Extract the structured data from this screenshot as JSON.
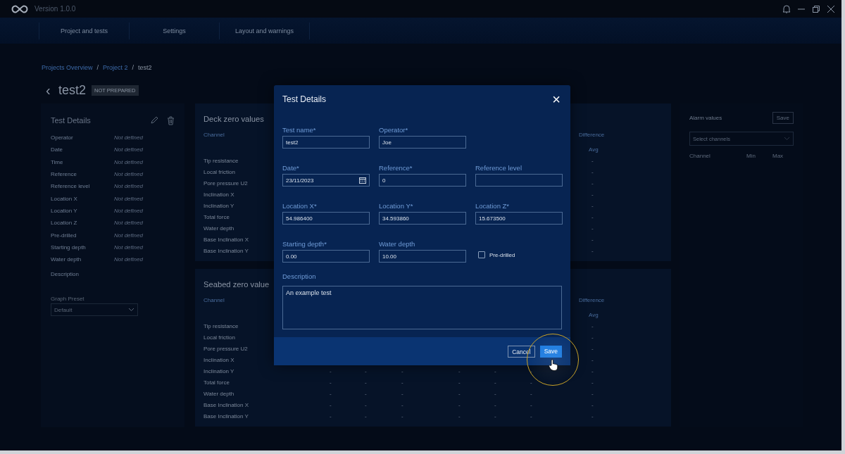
{
  "titlebar": {
    "version": "Version 1.0.0"
  },
  "nav": {
    "tabs": [
      {
        "label": "Project and tests"
      },
      {
        "label": "Settings"
      },
      {
        "label": "Layout and warnings"
      }
    ]
  },
  "breadcrumb": {
    "links": [
      "Projects Overview",
      "Project 2"
    ],
    "separator": "/",
    "current": "test2"
  },
  "page": {
    "back": "‹",
    "title": "test2",
    "status": "NOT PREPARED"
  },
  "details": {
    "title": "Test Details",
    "rows": [
      {
        "label": "Operator",
        "value": "Not defined"
      },
      {
        "label": "Date",
        "value": "Not defined"
      },
      {
        "label": "Time",
        "value": "Not defined"
      },
      {
        "label": "Reference",
        "value": "Not defined"
      },
      {
        "label": "Reference level",
        "value": "Not defined"
      },
      {
        "label": "Location X",
        "value": "Not defined"
      },
      {
        "label": "Location Y",
        "value": "Not defined"
      },
      {
        "label": "Location Z",
        "value": "Not defined"
      },
      {
        "label": "Pre-drilled",
        "value": "Not defined"
      },
      {
        "label": "Starting depth",
        "value": "Not defined"
      },
      {
        "label": "Water depth",
        "value": "Not defined"
      }
    ],
    "description_label": "Description",
    "preset_label": "Graph Preset",
    "preset_value": "Default"
  },
  "zero_tables": [
    {
      "title": "Deck zero values",
      "header": {
        "channel": "Channel",
        "group": "Difference",
        "sub": "Avg"
      },
      "rows": [
        {
          "channel": "Tip resistance",
          "values": [
            "-"
          ]
        },
        {
          "channel": "Local friction",
          "values": [
            "-"
          ]
        },
        {
          "channel": "Pore pressure U2",
          "values": [
            "-"
          ]
        },
        {
          "channel": "Inclination X",
          "values": [
            "-"
          ]
        },
        {
          "channel": "Inclination Y",
          "values": [
            "-"
          ]
        },
        {
          "channel": "Total force",
          "values": [
            "-"
          ]
        },
        {
          "channel": "Water depth",
          "values": [
            "-"
          ]
        },
        {
          "channel": "Base Inclination X",
          "values": [
            "-"
          ]
        },
        {
          "channel": "Base Inclination Y",
          "values": [
            "-"
          ]
        }
      ]
    },
    {
      "title": "Seabed zero value",
      "header": {
        "channel": "Channel",
        "group": "Difference",
        "sub": "Avg"
      },
      "rows": [
        {
          "channel": "Tip resistance",
          "values": [
            "-"
          ]
        },
        {
          "channel": "Local friction",
          "values": [
            "-"
          ]
        },
        {
          "channel": "Pore pressure U2",
          "values": [
            "-"
          ]
        },
        {
          "channel": "Inclination X",
          "values": [
            "-"
          ]
        },
        {
          "channel": "Inclination Y",
          "values": [
            "-",
            "-",
            "-",
            "-",
            "-",
            "-",
            "-"
          ]
        },
        {
          "channel": "Total force",
          "values": [
            "-",
            "-",
            "-",
            "-",
            "-",
            "-",
            "-"
          ]
        },
        {
          "channel": "Water depth",
          "values": [
            "-",
            "-",
            "-",
            "-",
            "-",
            "-",
            "-"
          ]
        },
        {
          "channel": "Base Inclination X",
          "values": [
            "-",
            "-",
            "-",
            "-",
            "-",
            "-",
            "-"
          ]
        },
        {
          "channel": "Base Inclination Y",
          "values": [
            "-",
            "-",
            "-",
            "-",
            "-",
            "-",
            "-"
          ]
        }
      ]
    }
  ],
  "alarm": {
    "title": "Alarm values",
    "save": "Save",
    "select_placeholder": "Select channels",
    "columns": [
      "Channel",
      "Min",
      "Max"
    ]
  },
  "modal": {
    "title": "Test Details",
    "close": "×",
    "rows": [
      [
        {
          "kind": "text",
          "label": "Test name*",
          "value": "test2"
        },
        {
          "kind": "text",
          "label": "Operator*",
          "value": "Joe"
        }
      ],
      [
        {
          "kind": "date",
          "label": "Date*",
          "value": "23/11/2023"
        },
        {
          "kind": "text",
          "label": "Reference*",
          "value": "0"
        },
        {
          "kind": "text",
          "label": "Reference level"
        }
      ],
      [
        {
          "kind": "text",
          "label": "Location X*",
          "value": "54.986400"
        },
        {
          "kind": "text",
          "label": "Location Y*",
          "value": "34.593860"
        },
        {
          "kind": "text",
          "label": "Location Z*",
          "value": "15.673500"
        }
      ],
      [
        {
          "kind": "text",
          "label": "Starting depth*",
          "value": "0.00"
        },
        {
          "kind": "text",
          "label": "Water depth",
          "value": "10.00"
        },
        {
          "kind": "checkbox",
          "label": "Pre-drilled",
          "checked": false
        }
      ]
    ],
    "description": {
      "label": "Description",
      "value": "An example test"
    },
    "buttons": [
      {
        "kind": "secondary",
        "label": "Cancel"
      },
      {
        "kind": "primary",
        "label": "Save"
      }
    ]
  }
}
